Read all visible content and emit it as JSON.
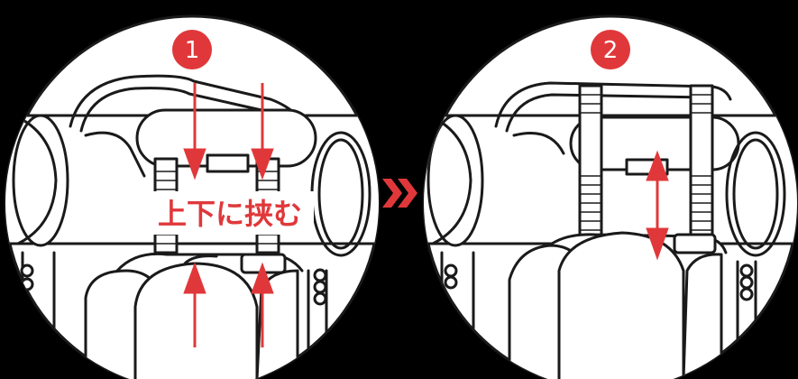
{
  "steps": [
    {
      "number": "1",
      "caption": "上下に挟む"
    },
    {
      "number": "2"
    }
  ],
  "colors": {
    "accent": "#e0383a",
    "line": "#1a1a1a",
    "panel": "#ffffff",
    "background": "#000000"
  },
  "icons": {
    "separator": "double-chevron-right-icon"
  }
}
